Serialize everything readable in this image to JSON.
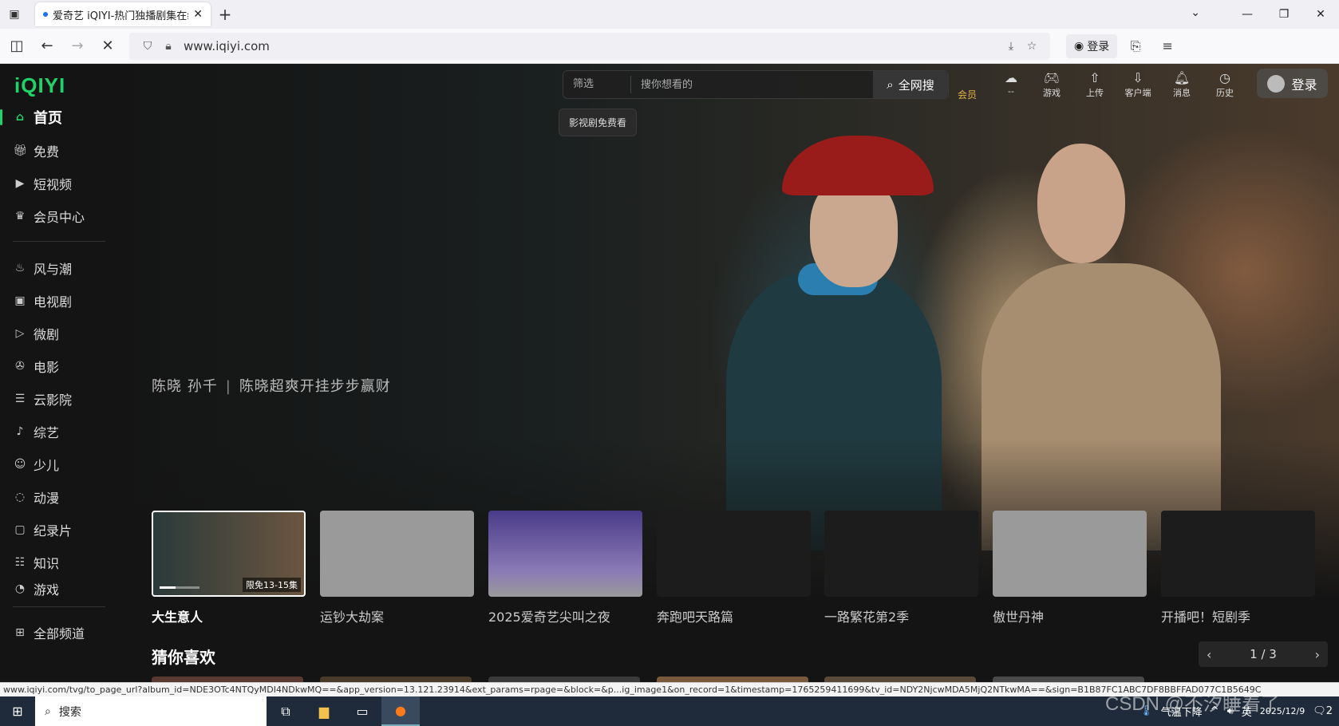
{
  "browser": {
    "tab_title": "爱奇艺 iQIYI-热门独播剧集在线",
    "url": "www.iqiyi.com",
    "login_label": "登录",
    "status_url": "www.iqiyi.com/tvg/to_page_url?album_id=NDE3OTc4NTQyMDI4NDkwMQ==&app_version=13.121.23914&ext_params=rpage=&block=&p...ig_image1&on_record=1&timestamp=1765259411699&tv_id=NDY2NjcwMDA5MjQ2NTkwMA==&sign=B1B87FC1ABC7DF8BBFFAD077C1B5649C"
  },
  "site": {
    "logo": "iQIYI",
    "search": {
      "filter_label": "筛选",
      "placeholder": "搜你想看的",
      "button_label": "全网搜",
      "tooltip": "影视剧免费看"
    },
    "header_icons": [
      {
        "label": "--",
        "icon": "cloud-icon"
      },
      {
        "label": "游戏",
        "icon": "gamepad-icon"
      },
      {
        "label": "上传",
        "icon": "upload-icon"
      },
      {
        "label": "客户端",
        "icon": "download-icon"
      },
      {
        "label": "消息",
        "icon": "bell-icon"
      },
      {
        "label": "历史",
        "icon": "clock-icon"
      }
    ],
    "vip_label": "会员",
    "login_label": "登录"
  },
  "sidebar": {
    "items": [
      {
        "label": "首页",
        "icon": "home-icon"
      },
      {
        "label": "免费",
        "icon": "gift-icon"
      },
      {
        "label": "短视频",
        "icon": "play-square-icon"
      },
      {
        "label": "会员中心",
        "icon": "crown-icon"
      },
      {
        "label": "风与潮",
        "icon": "flame-icon"
      },
      {
        "label": "电视剧",
        "icon": "tv-icon"
      },
      {
        "label": "微剧",
        "icon": "mini-play-icon"
      },
      {
        "label": "电影",
        "icon": "film-reel-icon"
      },
      {
        "label": "云影院",
        "icon": "cloud-cinema-icon"
      },
      {
        "label": "综艺",
        "icon": "mic-icon"
      },
      {
        "label": "少儿",
        "icon": "kids-icon"
      },
      {
        "label": "动漫",
        "icon": "anime-icon"
      },
      {
        "label": "纪录片",
        "icon": "documentary-icon"
      },
      {
        "label": "知识",
        "icon": "book-icon"
      },
      {
        "label": "游戏",
        "icon": "game-icon"
      },
      {
        "label": "全部频道",
        "icon": "grid-icon"
      }
    ]
  },
  "hero": {
    "cast": "陈晓 孙千",
    "separator": "|",
    "tagline": "陈晓超爽开挂步步赢财"
  },
  "carousel": [
    {
      "title": "大生意人",
      "badge": "限免13-15集"
    },
    {
      "title": "运钞大劫案",
      "badge": ""
    },
    {
      "title": "2025爱奇艺尖叫之夜",
      "badge": ""
    },
    {
      "title": "奔跑吧天路篇",
      "badge": ""
    },
    {
      "title": "一路繁花第2季",
      "badge": ""
    },
    {
      "title": "傲世丹神",
      "badge": ""
    },
    {
      "title": "开播吧！短剧季",
      "badge": ""
    }
  ],
  "recommend": {
    "title": "猜你喜欢",
    "pager": "1 / 3"
  },
  "taskbar": {
    "search_label": "搜索",
    "weather": "气温下降",
    "ime": "英",
    "date": "2025/12/9",
    "notify_count": "2"
  },
  "watermark": "CSDN @不汐睡着了",
  "colors": {
    "accent": "#1fd26a",
    "vip": "#e3b04b"
  }
}
